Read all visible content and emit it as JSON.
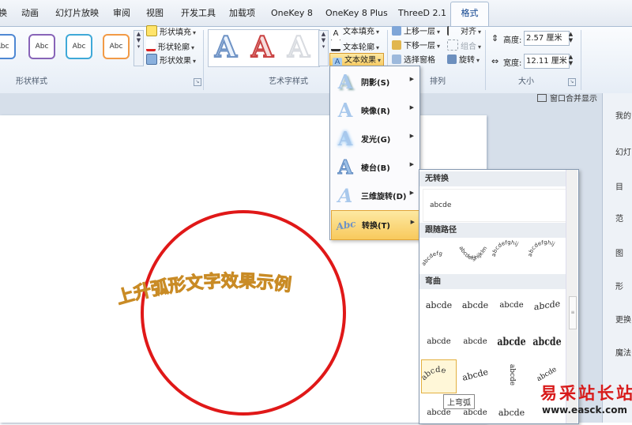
{
  "tabs": [
    "换",
    "动画",
    "幻灯片放映",
    "审阅",
    "视图",
    "开发工具",
    "加载项",
    "OneKey 8",
    "OneKey 8 Plus",
    "ThreeD 2.1",
    "格式"
  ],
  "ribbon": {
    "shape_styles": {
      "samples": [
        "Abc",
        "Abc",
        "Abc",
        "Abc"
      ],
      "fill": "形状填充",
      "outline": "形状轮廓",
      "effects": "形状效果",
      "label": "形状样式"
    },
    "art_styles": {
      "letters": [
        "A",
        "A",
        "A"
      ],
      "text_fill": "文本填充",
      "text_outline": "文本轮廓",
      "text_effects": "文本效果",
      "label": "艺术字样式"
    },
    "arrange": {
      "bring_forward": "上移一层",
      "send_backward": "下移一层",
      "selection_pane": "选择窗格",
      "align": "对齐",
      "group": "组合",
      "rotate": "旋转",
      "label": "排列"
    },
    "size": {
      "height_label": "高度:",
      "height_value": "2.57 厘米",
      "width_label": "宽度:",
      "width_value": "12.11 厘米",
      "label": "大小"
    }
  },
  "window_merge": "窗口合并显示",
  "right_pane": [
    "我的",
    "幻灯",
    "目",
    "范",
    "图",
    "形",
    "更换",
    "魔法"
  ],
  "effects_menu": [
    {
      "glyph": "A",
      "label": "阴影(S)"
    },
    {
      "glyph": "A",
      "label": "映像(R)"
    },
    {
      "glyph": "A",
      "label": "发光(G)"
    },
    {
      "glyph": "A",
      "label": "棱台(B)"
    },
    {
      "glyph": "A",
      "label": "三维旋转(D)"
    },
    {
      "glyph": "Abc",
      "label": "转换(T)"
    }
  ],
  "submenu": {
    "no_transform": "无转换",
    "plain_sample": "abcde",
    "follow_path": "跟随路径",
    "warp": "弯曲",
    "path_texts": [
      "abcdefg",
      "abcdefghijklm",
      "abcdefghij",
      "abcdefghij"
    ],
    "warp_row1": [
      "abcde",
      "abcde",
      "abcde",
      "abcde"
    ],
    "warp_row2": [
      "abcde",
      "abcde",
      "abcde",
      "abcde"
    ],
    "warp_row3": [
      "abcde",
      "abcde",
      "abcde",
      "abcde"
    ],
    "warp_row4": [
      "abcde",
      "abcde",
      "abcde"
    ]
  },
  "tooltip": "上弯弧",
  "slide": {
    "wordart": "上升弧形文字效果示例"
  },
  "watermark": {
    "title": "易采站长站",
    "url": "www.easck.com"
  },
  "colors": {
    "accent": "#f0b440",
    "circle": "#e01818",
    "wordart": "#e8a83a"
  }
}
